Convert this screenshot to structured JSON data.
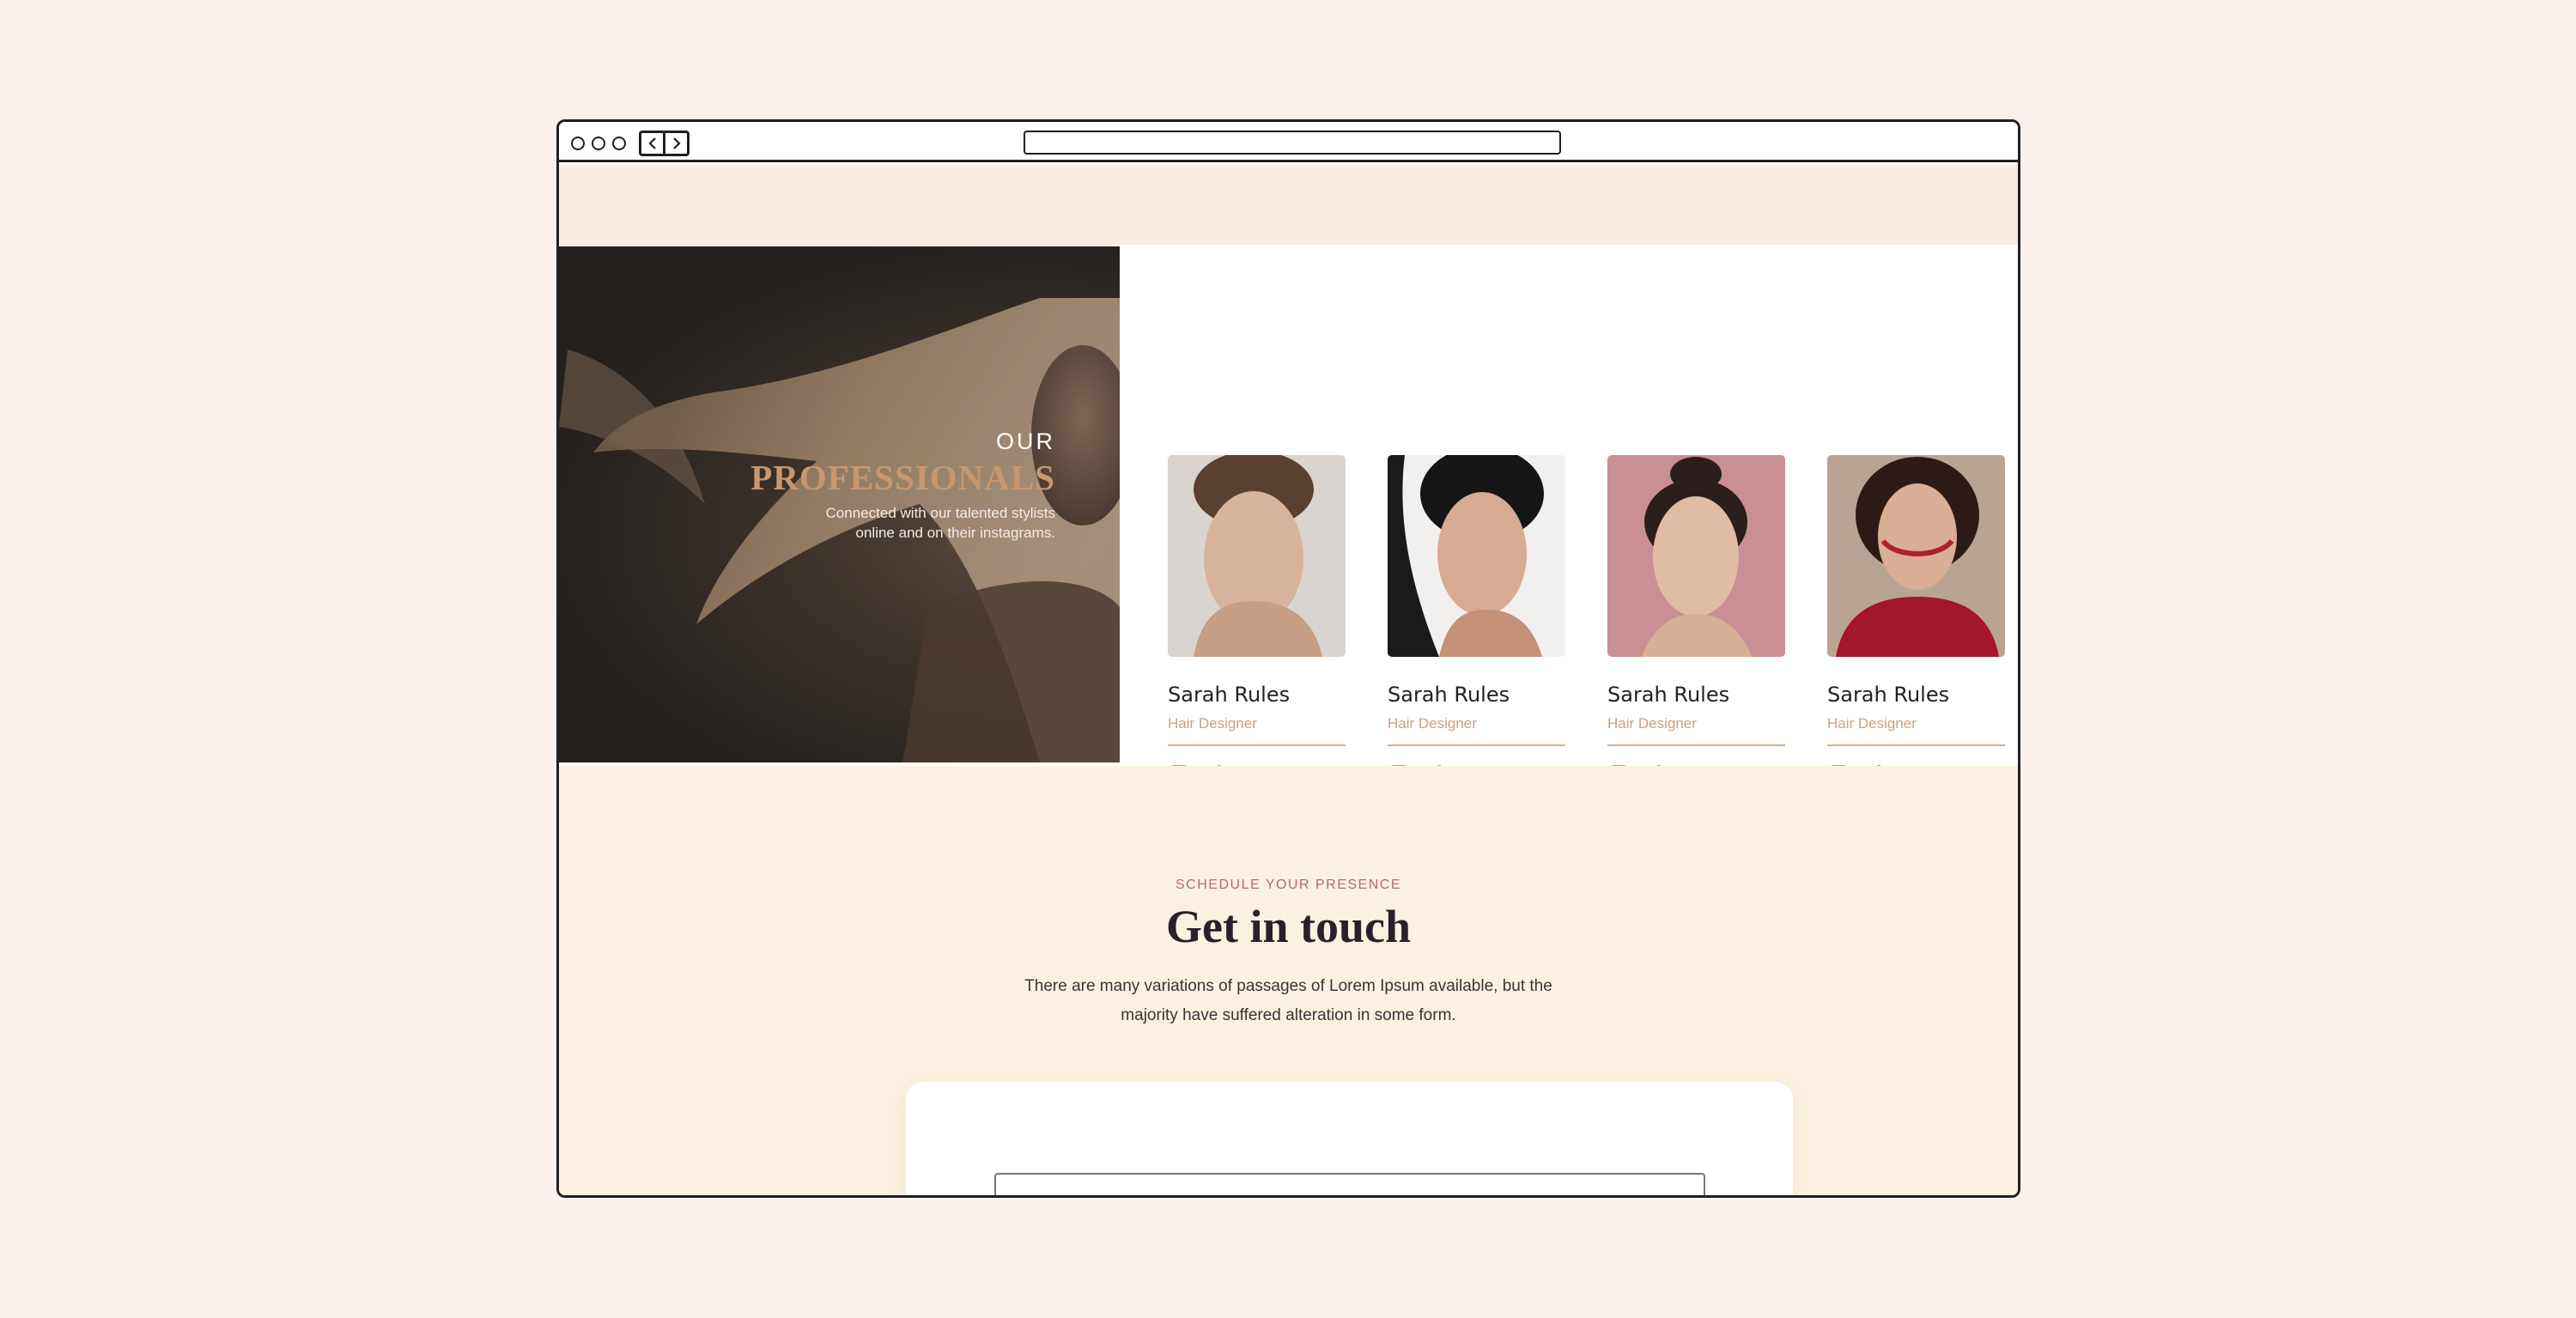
{
  "browser": {
    "address_value": ""
  },
  "hero": {
    "kicker": "OUR",
    "title": "PROFESSIONALS",
    "subtitle": "Connected with our talented stylists online and on their instagrams."
  },
  "team": [
    {
      "name": "Sarah Rules",
      "role": "Hair Designer",
      "photo_bg": "#d9d4cf",
      "photo_accent": "#3a2c24"
    },
    {
      "name": "Sarah Rules",
      "role": "Hair Designer",
      "photo_bg": "#f2f0ee",
      "photo_accent": "#141414"
    },
    {
      "name": "Sarah Rules",
      "role": "Hair Designer",
      "photo_bg": "#c98f95",
      "photo_accent": "#2a1f1c"
    },
    {
      "name": "Sarah Rules",
      "role": "Hair Designer",
      "photo_bg": "#b8a495",
      "photo_accent": "#2b1a16"
    }
  ],
  "socials": [
    "instagram-icon",
    "tiktok-icon"
  ],
  "contact": {
    "eyebrow": "SCHEDULE YOUR PRESENCE",
    "headline": "Get in touch",
    "lead": "There are many variations of passages of Lorem Ipsum available, but the majority have suffered alteration in some form.",
    "field_placeholder": ""
  },
  "colors": {
    "accent": "#c9976e",
    "role_text": "#d09e7a",
    "eyebrow": "#b46a7a",
    "headline": "#2b1f2d",
    "contact_bg": "#fbf1e0",
    "top_band": "#f9ece2"
  }
}
